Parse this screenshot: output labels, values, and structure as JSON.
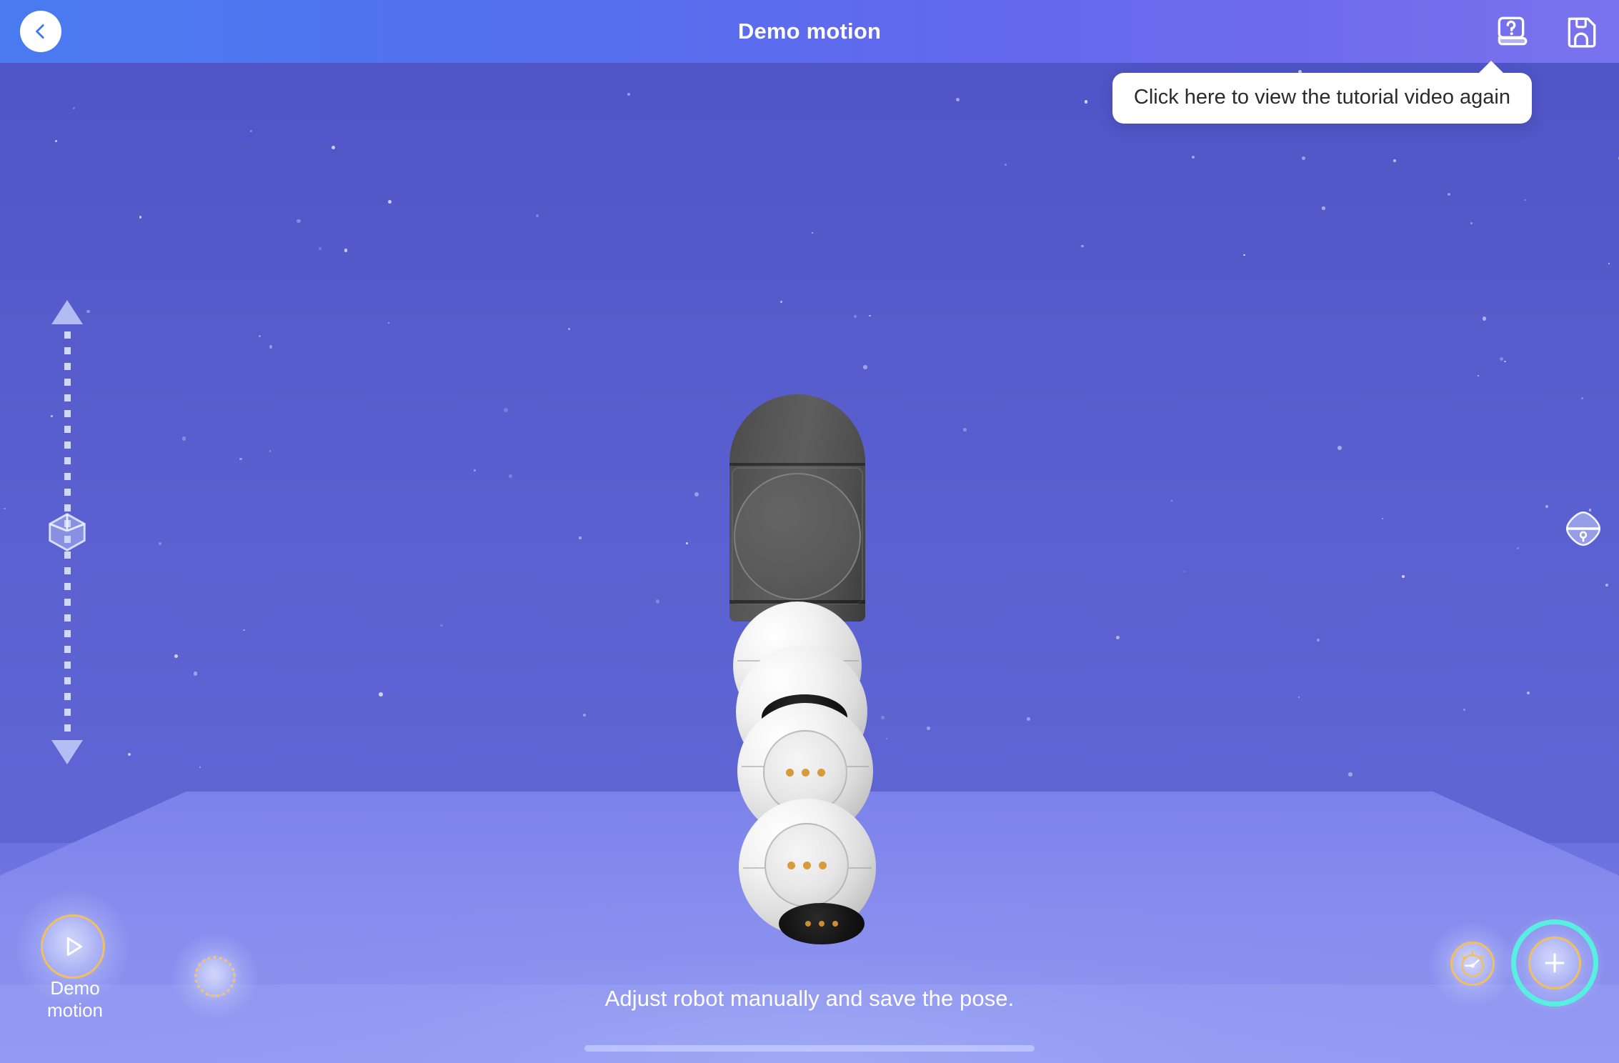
{
  "header": {
    "title": "Demo motion",
    "back_icon": "chevron-left-icon",
    "help_icon": "help-book-icon",
    "save_icon": "floppy-disk-save-icon"
  },
  "tooltip": {
    "text": "Click here to view the tutorial video again"
  },
  "viewport": {
    "vertical_slider": {
      "up_icon": "triangle-up-icon",
      "down_icon": "triangle-down-icon",
      "handle_icon": "cube-3d-icon"
    },
    "right_control": {
      "icon": "view-orientation-icon"
    },
    "robot": {
      "name": "modular-robot-arm",
      "segments": [
        "head-module",
        "joint-module-1",
        "joint-module-2",
        "joint-module-3",
        "joint-module-4"
      ]
    }
  },
  "bottom": {
    "hint_text": "Adjust robot manually and save the pose.",
    "demo_button": {
      "label": "Demo motion",
      "icon": "play-icon",
      "ring_color": "#f0c060"
    },
    "empty_slot": {
      "icon": "dotted-circle-placeholder",
      "border_color": "#f2c56a"
    },
    "timer_button": {
      "icon": "stopwatch-icon",
      "ring_color": "#f0c060"
    },
    "add_button": {
      "icon": "plus-icon",
      "ring_color": "#f0c060",
      "highlight_color": "#57f0e0"
    }
  },
  "colors": {
    "header_start": "#4a7bf0",
    "header_end": "#7a73ef",
    "background_top": "#4e53c6",
    "floor": "#868ced",
    "accent_gold": "#f0c060",
    "accent_cyan": "#57f0e0"
  }
}
